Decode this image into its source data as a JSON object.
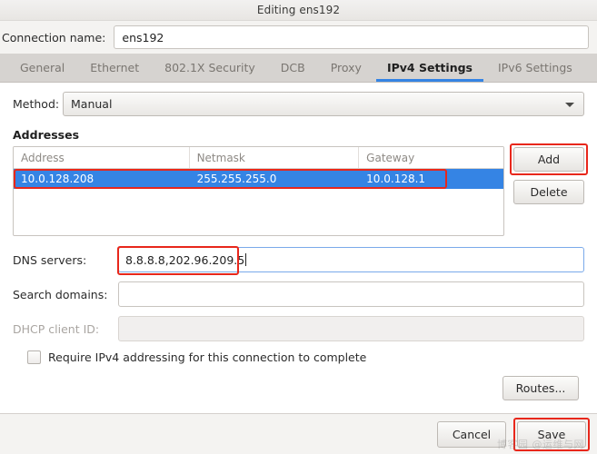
{
  "window": {
    "title": "Editing ens192"
  },
  "connection": {
    "label": "Connection name:",
    "value": "ens192",
    "placeholder": ""
  },
  "tabs": [
    {
      "label": "General",
      "active": false
    },
    {
      "label": "Ethernet",
      "active": false
    },
    {
      "label": "802.1X Security",
      "active": false
    },
    {
      "label": "DCB",
      "active": false
    },
    {
      "label": "Proxy",
      "active": false
    },
    {
      "label": "IPv4 Settings",
      "active": true
    },
    {
      "label": "IPv6 Settings",
      "active": false
    }
  ],
  "method": {
    "label": "Method:",
    "value": "Manual",
    "arrow_icon": "chevron-down-icon"
  },
  "addresses": {
    "section_label": "Addresses",
    "columns": [
      "Address",
      "Netmask",
      "Gateway"
    ],
    "rows": [
      {
        "address": "10.0.128.208",
        "netmask": "255.255.255.0",
        "gateway": "10.0.128.1",
        "selected": true
      }
    ],
    "add_label": "Add",
    "delete_label": "Delete"
  },
  "dns": {
    "label": "DNS servers:",
    "value": "8.8.8.8,202.96.209.5",
    "placeholder": ""
  },
  "search_domains": {
    "label": "Search domains:",
    "value": "",
    "placeholder": ""
  },
  "dhcp_client_id": {
    "label": "DHCP client ID:",
    "value": "",
    "placeholder": "",
    "disabled": true
  },
  "require_ipv4": {
    "label": "Require IPv4 addressing for this connection to complete",
    "checked": false
  },
  "routes": {
    "label": "Routes..."
  },
  "actions": {
    "cancel_label": "Cancel",
    "save_label": "Save"
  },
  "watermark": {
    "text": "博客园 @运维与网"
  },
  "colors": {
    "accent": "#3584e4",
    "annotation": "#e8271b",
    "tab_bar": "#d6d3d0",
    "page_bg": "#ffffff"
  }
}
